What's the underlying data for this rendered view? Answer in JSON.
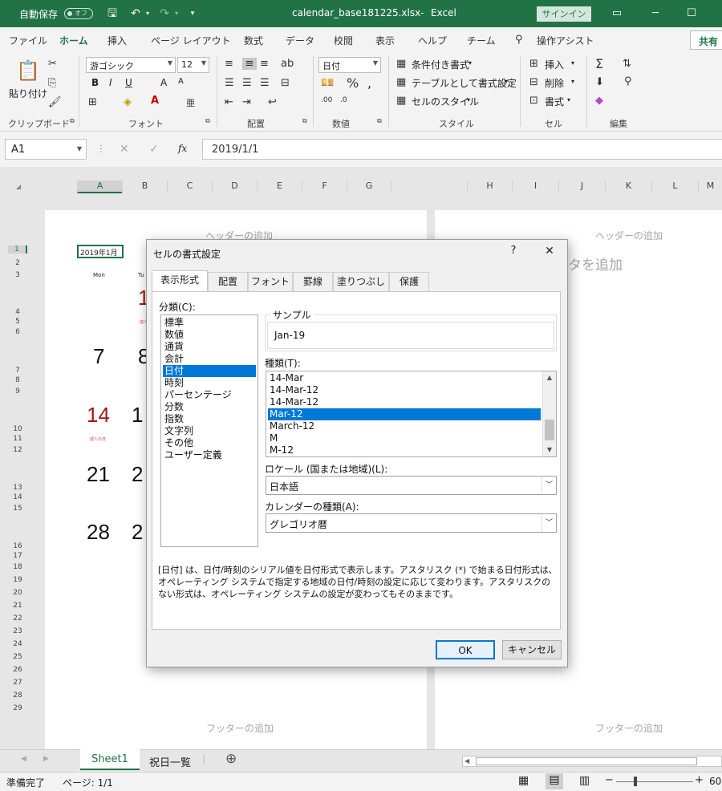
{
  "titlebar": {
    "autosave_label": "自動保存",
    "autosave_state": "オフ",
    "filename": "calendar_base181225.xlsx",
    "separator": "-",
    "app": "Excel",
    "signin": "サインイン"
  },
  "ribbon_tabs": [
    "ファイル",
    "ホーム",
    "挿入",
    "ページ レイアウト",
    "数式",
    "データ",
    "校閲",
    "表示",
    "ヘルプ",
    "チーム",
    "操作アシスト"
  ],
  "share_label": "共有",
  "ribbon": {
    "clipboard": {
      "paste": "貼り付け",
      "label": "クリップボード"
    },
    "font": {
      "name": "游ゴシック",
      "size": "12",
      "bold": "B",
      "italic": "I",
      "underline": "U",
      "grow": "A",
      "shrink": "A",
      "label": "フォント"
    },
    "alignment": {
      "label": "配置"
    },
    "number": {
      "format": "日付",
      "label": "数値"
    },
    "styles": {
      "conditional": "条件付き書式",
      "table": "テーブルとして書式設定",
      "cellstyle": "セルのスタイル",
      "label": "スタイル"
    },
    "cells": {
      "insert": "挿入",
      "delete": "削除",
      "format": "書式",
      "label": "セル"
    },
    "editing": {
      "label": "編集"
    }
  },
  "formula_bar": {
    "namebox": "A1",
    "fx": "fx",
    "content": "2019/1/1"
  },
  "columns_left": [
    "A",
    "B",
    "C",
    "D",
    "E",
    "F",
    "G"
  ],
  "columns_right": [
    "H",
    "I",
    "J",
    "K",
    "L",
    "M"
  ],
  "rows": [
    "1",
    "2",
    "3",
    "4",
    "5",
    "6",
    "7",
    "8",
    "9",
    "10",
    "11",
    "12",
    "13",
    "14",
    "15",
    "16",
    "17",
    "18",
    "19",
    "20",
    "21",
    "22",
    "23",
    "24",
    "25",
    "26",
    "27",
    "28",
    "29"
  ],
  "sheet": {
    "header_add": "ヘッダーの追加",
    "header_data_add": "タを追加",
    "footer_add": "フッターの追加",
    "a1_value": "2019年1月",
    "b3_text": "Mon",
    "c3_text": "Tu",
    "cal_numbers": [
      "1",
      "7",
      "8",
      "14",
      "1",
      "21",
      "2",
      "28",
      "2"
    ],
    "holiday_small": "成人の日"
  },
  "sheet_tabs": [
    "Sheet1",
    "祝日一覧"
  ],
  "status": {
    "ready": "準備完了",
    "page": "ページ: 1/1",
    "zoom": "60"
  },
  "dialog": {
    "title": "セルの書式設定",
    "help": "?",
    "close": "✕",
    "tabs": [
      "表示形式",
      "配置",
      "フォント",
      "罫線",
      "塗りつぶし",
      "保護"
    ],
    "category_label": "分類(C):",
    "categories": [
      "標準",
      "数値",
      "通貨",
      "会計",
      "日付",
      "時刻",
      "パーセンテージ",
      "分数",
      "指数",
      "文字列",
      "その他",
      "ユーザー定義"
    ],
    "selected_category": "日付",
    "sample_label": "サンプル",
    "sample_value": "Jan-19",
    "type_label": "種類(T):",
    "types": [
      "14-Mar",
      "14-Mar-12",
      "14-Mar-12",
      "Mar-12",
      "March-12",
      "M",
      "M-12"
    ],
    "selected_type": "Mar-12",
    "locale_label": "ロケール (国または地域)(L):",
    "locale_value": "日本語",
    "calendar_label": "カレンダーの種類(A):",
    "calendar_value": "グレゴリオ暦",
    "description": "[日付] は、日付/時刻のシリアル値を日付形式で表示します。アスタリスク (*) で始まる日付形式は、オペレーティング システムで指定する地域の日付/時刻の設定に応じて変わります。アスタリスクのない形式は、オペレーティング システムの設定が変わってもそのままです。",
    "ok": "OK",
    "cancel": "キャンセル"
  }
}
